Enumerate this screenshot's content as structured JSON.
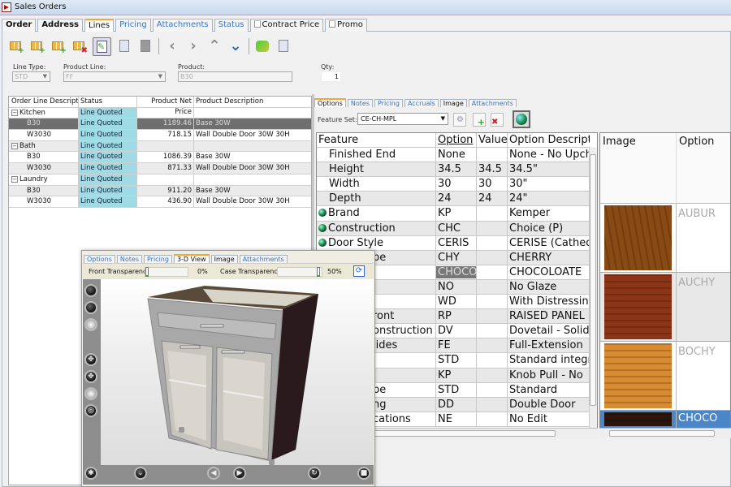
{
  "window": {
    "title": "Sales Orders"
  },
  "main_tabs": [
    {
      "label": "Order",
      "style": "dark"
    },
    {
      "label": "Address",
      "style": "dark"
    },
    {
      "label": "Lines",
      "style": "active"
    },
    {
      "label": "Pricing",
      "style": "link"
    },
    {
      "label": "Attachments",
      "style": "link"
    },
    {
      "label": "Status",
      "style": "link"
    },
    {
      "label": "Contract Price",
      "style": "doc"
    },
    {
      "label": "Promo",
      "style": "doc"
    }
  ],
  "toolbar": {
    "icons": [
      "add-line-icon",
      "add-group-icon",
      "insert-line-icon",
      "delete-line-icon",
      "edit-icon",
      "copy-icon",
      "paste-icon",
      "previous-icon",
      "next-icon",
      "move-up-icon",
      "move-down-icon",
      "pricing-icon",
      "export-icon"
    ]
  },
  "form": {
    "line_type": {
      "label": "Line Type:",
      "value": "STD"
    },
    "product_line": {
      "label": "Product Line:",
      "value": "FF"
    },
    "product": {
      "label": "Product:",
      "value": "B30"
    },
    "qty": {
      "label": "Qty:",
      "value": "1"
    }
  },
  "lines_grid": {
    "columns": [
      "Order Line Description",
      "Status Description",
      "Product Net Price",
      "Product Description"
    ],
    "rows": [
      {
        "desc": "Kitchen",
        "status": "Line Quoted",
        "price": "",
        "product": "",
        "group": true
      },
      {
        "desc": "B30",
        "status": "Line Quoted",
        "price": "1189.46",
        "product": "Base 30W",
        "selected": true
      },
      {
        "desc": "W3030",
        "status": "Line Quoted",
        "price": "718.15",
        "product": "Wall Double Door 30W 30H"
      },
      {
        "desc": "Bath",
        "status": "Line Quoted",
        "price": "",
        "product": "",
        "group": true
      },
      {
        "desc": "B30",
        "status": "Line Quoted",
        "price": "1086.39",
        "product": "Base 30W"
      },
      {
        "desc": "W3030",
        "status": "Line Quoted",
        "price": "871.33",
        "product": "Wall Double Door 30W 30H"
      },
      {
        "desc": "Laundry",
        "status": "Line Quoted",
        "price": "",
        "product": "",
        "group": true
      },
      {
        "desc": "B30",
        "status": "Line Quoted",
        "price": "911.20",
        "product": "Base 30W"
      },
      {
        "desc": "W3030",
        "status": "Line Quoted",
        "price": "436.90",
        "product": "Wall Double Door 30W 30H"
      }
    ]
  },
  "options_panel": {
    "tabs": [
      {
        "label": "Options",
        "style": "active"
      },
      {
        "label": "Notes",
        "style": "link"
      },
      {
        "label": "Pricing",
        "style": "link"
      },
      {
        "label": "Accruals",
        "style": "link"
      },
      {
        "label": "Image",
        "style": "plain"
      },
      {
        "label": "Attachments",
        "style": "link"
      }
    ],
    "feature_set_label": "Feature Set:",
    "feature_set_value": "CE-CH-MPL",
    "columns": [
      "Feature",
      "Option",
      "Value",
      "Option Descripti"
    ],
    "rows": [
      {
        "feature": "Finished End",
        "option": "None",
        "value": "",
        "description": "None - No Upcharge",
        "indent": true
      },
      {
        "feature": "Height",
        "option": "34.5",
        "value": "34.5",
        "description": "34.5\"",
        "indent": true
      },
      {
        "feature": "Width",
        "option": "30",
        "value": "30",
        "description": "30\"",
        "indent": true
      },
      {
        "feature": "Depth",
        "option": "24",
        "value": "24",
        "description": "24\"",
        "indent": true
      },
      {
        "feature": "Brand",
        "option": "KP",
        "value": "",
        "description": "Kemper",
        "globe": true
      },
      {
        "feature": "Construction",
        "option": "CHC",
        "value": "",
        "description": "Choice (P)",
        "globe": true
      },
      {
        "feature": "Door Style",
        "option": "CERIS",
        "value": "",
        "description": "CERISE (Cathedral)",
        "globe": true
      },
      {
        "feature": "pe",
        "option": "CHY",
        "value": "",
        "description": "CHERRY",
        "frag": true
      },
      {
        "feature": "",
        "option": "CHOCO",
        "value": "",
        "description": "CHOCOLOATE",
        "highlight": true
      },
      {
        "feature": "",
        "option": "NO",
        "value": "",
        "description": "No Glaze"
      },
      {
        "feature": "",
        "option": "WD",
        "value": "",
        "description": "With Distressing"
      },
      {
        "feature": "ront",
        "option": "RP",
        "value": "",
        "description": "RAISED PANEL",
        "frag": true
      },
      {
        "feature": "onstruction",
        "option": "DV",
        "value": "",
        "description": "Dovetail - Solid",
        "frag": true
      },
      {
        "feature": "lides",
        "option": "FE",
        "value": "",
        "description": "Full-Extension",
        "frag": true
      },
      {
        "feature": "",
        "option": "STD",
        "value": "",
        "description": "Standard integral"
      },
      {
        "feature": "",
        "option": "KP",
        "value": "",
        "description": "Knob Pull - No"
      },
      {
        "feature": "pe",
        "option": "STD",
        "value": "",
        "description": "Standard",
        "frag": true
      },
      {
        "feature": "ng",
        "option": "DD",
        "value": "",
        "description": "Double Door",
        "frag": true
      },
      {
        "feature": "cations",
        "option": "NE",
        "value": "",
        "description": "No Edit",
        "frag": true
      }
    ]
  },
  "image_panel": {
    "columns": [
      "Image",
      "Option"
    ],
    "rows": [
      {
        "option": "AUBUR",
        "swatch": "#8a4a14"
      },
      {
        "option": "AUCHY",
        "swatch": "#8c3416"
      },
      {
        "option": "BOCHY",
        "swatch": "#d88a30"
      },
      {
        "option": "CHOCO",
        "swatch": "#2a160e",
        "selected": true
      }
    ]
  },
  "view3d": {
    "tabs": [
      {
        "label": "Options",
        "style": "link"
      },
      {
        "label": "Notes",
        "style": "link"
      },
      {
        "label": "Pricing",
        "style": "link"
      },
      {
        "label": "3-D View",
        "style": "active"
      },
      {
        "label": "Image",
        "style": "plain"
      },
      {
        "label": "Attachments",
        "style": "link"
      }
    ],
    "front_transparency": {
      "label": "Front Transparency:",
      "value": "0%",
      "level": 0
    },
    "case_transparency": {
      "label": "Case Transparency:",
      "value": "50%",
      "level": 50
    }
  }
}
